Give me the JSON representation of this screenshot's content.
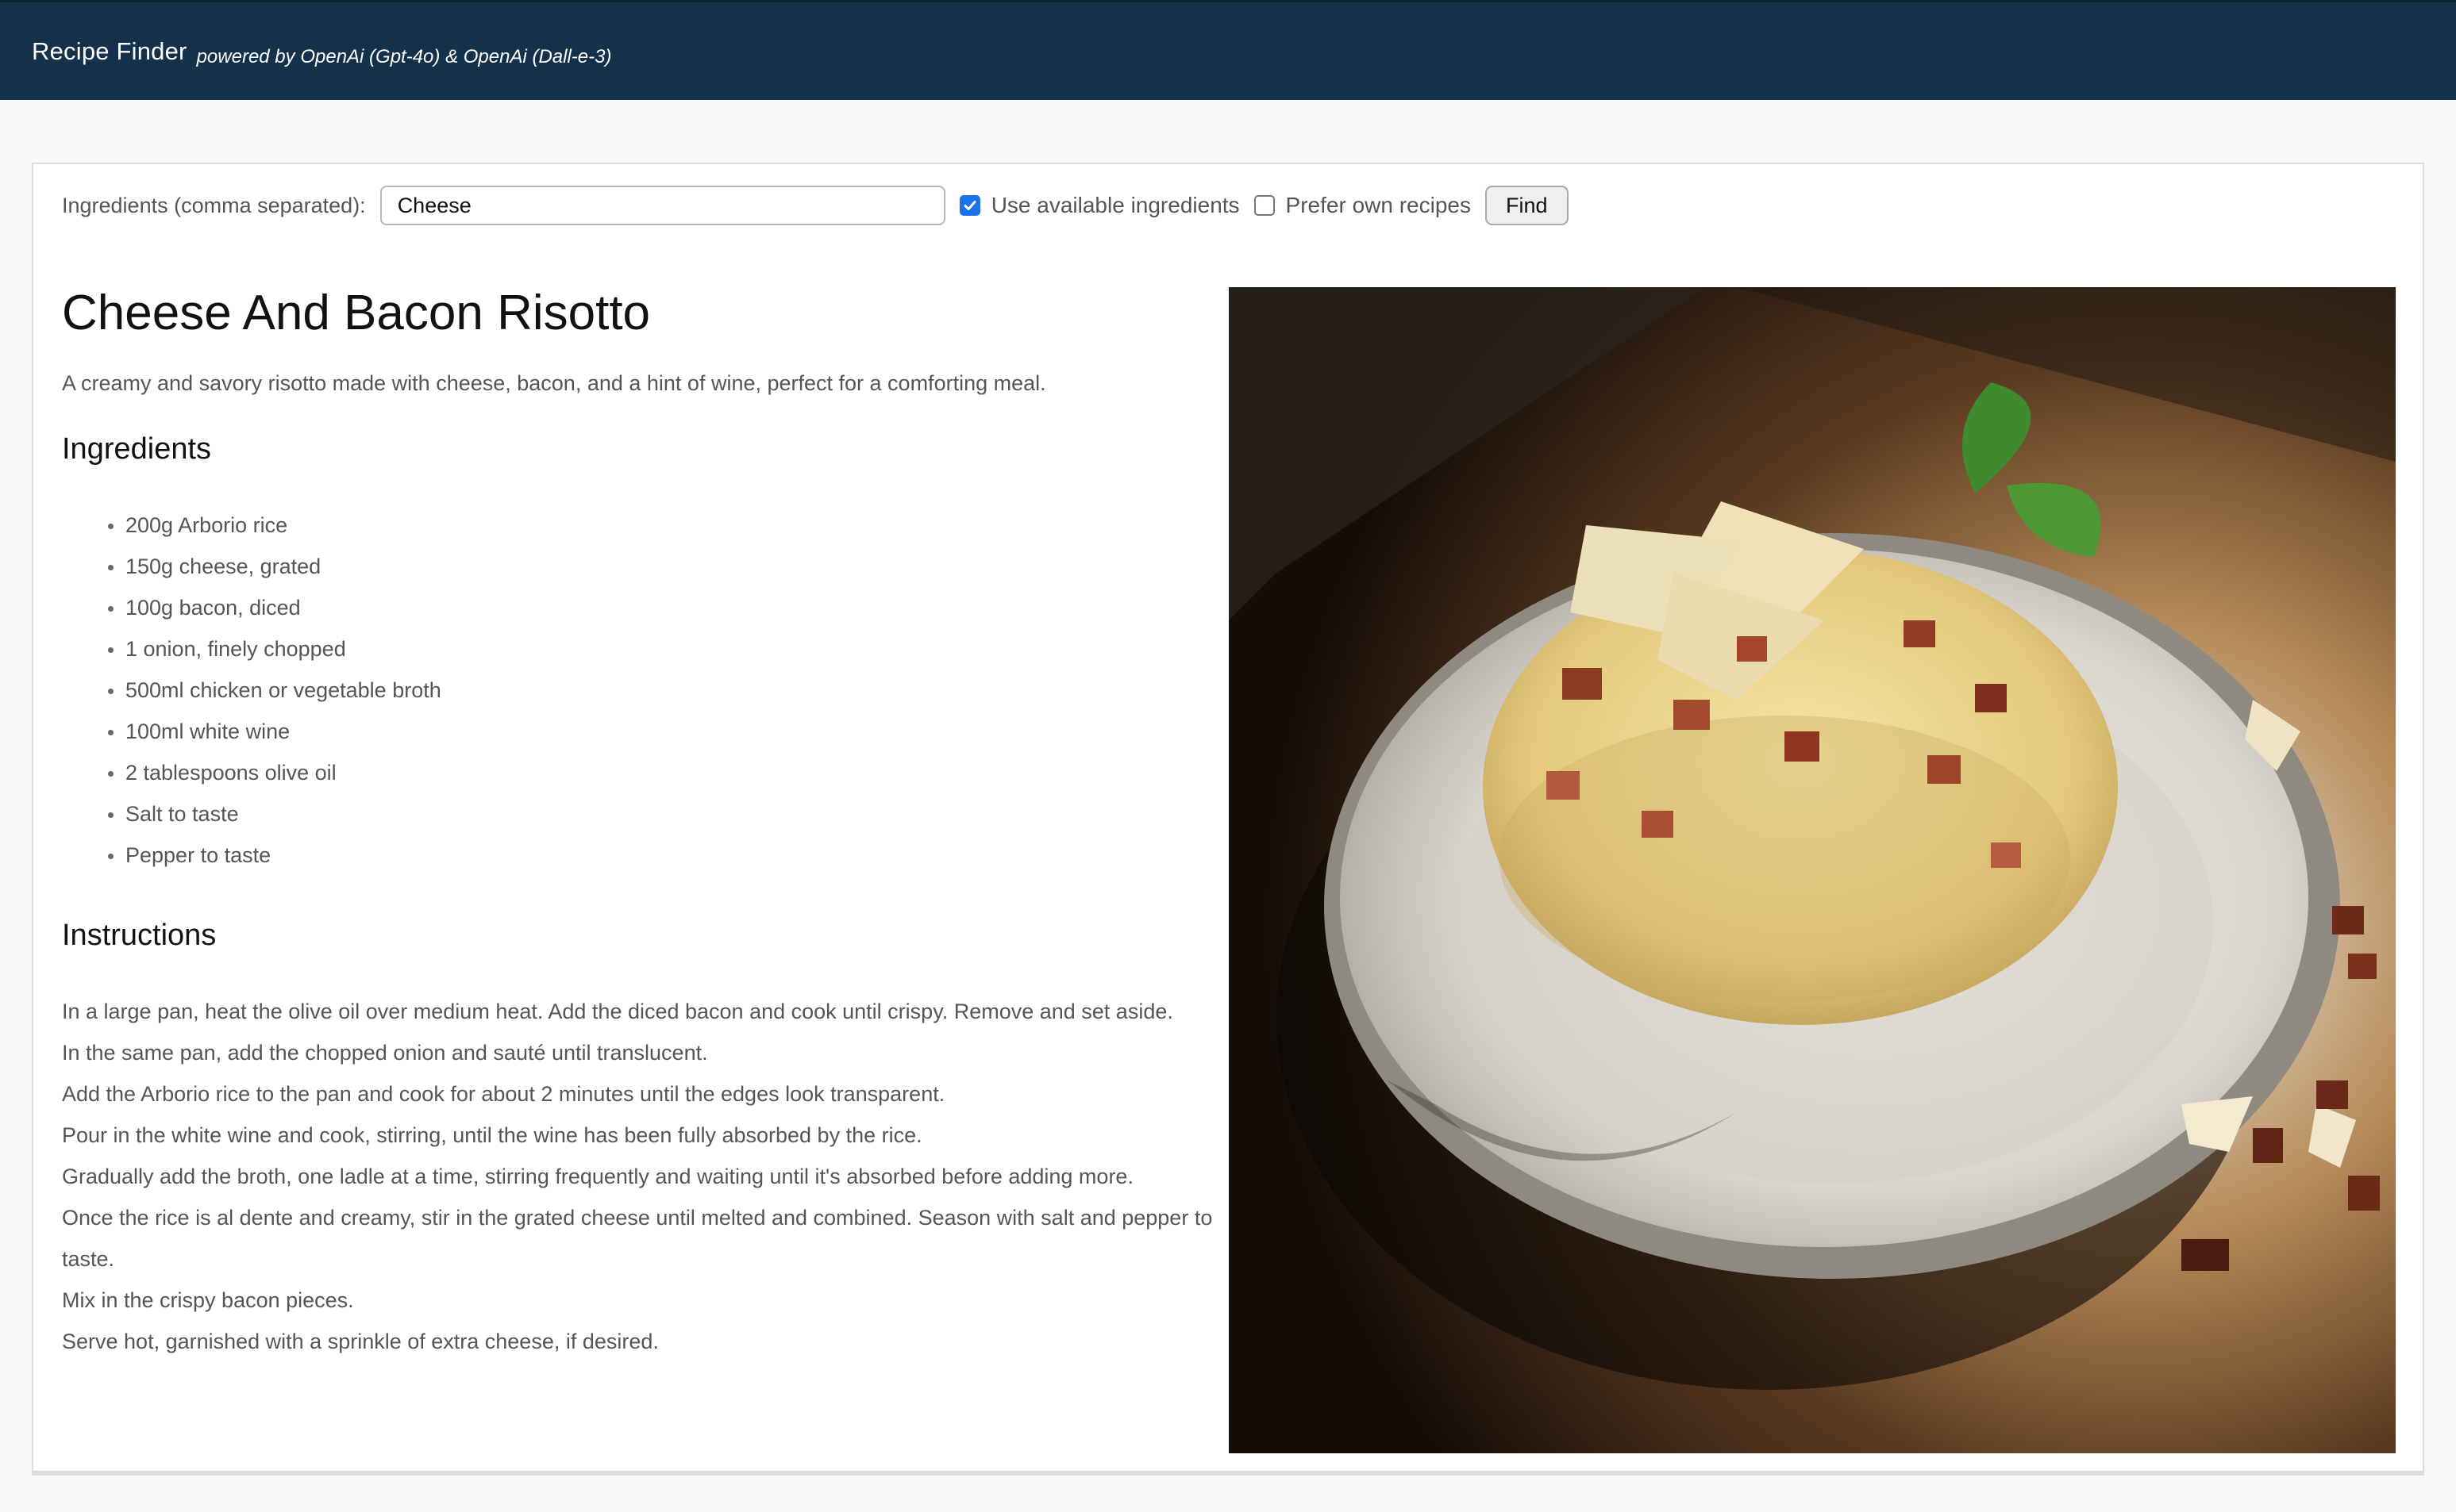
{
  "header": {
    "title": "Recipe Finder",
    "subtitle": "powered by OpenAi (Gpt-4o) & OpenAi (Dall-e-3)"
  },
  "search": {
    "label": "Ingredients (comma separated):",
    "value": "Cheese",
    "use_available_label": "Use available ingredients",
    "use_available_checked": true,
    "prefer_own_label": "Prefer own recipes",
    "prefer_own_checked": false,
    "find_label": "Find"
  },
  "recipe": {
    "title": "Cheese And Bacon Risotto",
    "description": "A creamy and savory risotto made with cheese, bacon, and a hint of wine, perfect for a comforting meal.",
    "ingredients_heading": "Ingredients",
    "ingredients": [
      "200g Arborio rice",
      "150g cheese, grated",
      "100g bacon, diced",
      "1 onion, finely chopped",
      "500ml chicken or vegetable broth",
      "100ml white wine",
      "2 tablespoons olive oil",
      "Salt to taste",
      "Pepper to taste"
    ],
    "instructions_heading": "Instructions",
    "instructions": [
      "In a large pan, heat the olive oil over medium heat. Add the diced bacon and cook until crispy. Remove and set aside.",
      "In the same pan, add the chopped onion and sauté until translucent.",
      "Add the Arborio rice to the pan and cook for about 2 minutes until the edges look transparent.",
      "Pour in the white wine and cook, stirring, until the wine has been fully absorbed by the rice.",
      "Gradually add the broth, one ladle at a time, stirring frequently and waiting until it's absorbed before adding more.",
      "Once the rice is al dente and creamy, stir in the grated cheese until melted and combined. Season with salt and pepper to taste.",
      "Mix in the crispy bacon pieces.",
      "Serve hot, garnished with a sprinkle of extra cheese, if desired."
    ]
  },
  "colors": {
    "header_bg": "#13314a",
    "checkbox_accent": "#1a73e8"
  }
}
